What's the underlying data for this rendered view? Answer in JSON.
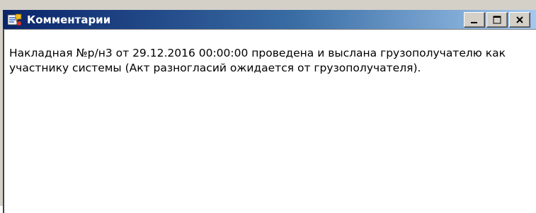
{
  "window": {
    "title": "Комментарии",
    "app_icon": "comments-app-icon",
    "buttons": {
      "minimize_icon": "minimize-icon",
      "maximize_icon": "maximize-icon",
      "close_icon": "close-icon"
    }
  },
  "comment": {
    "text": "Накладная №р/н3 от 29.12.2016 00:00:00 проведена  и выслана грузополучателю как участнику системы (Акт разногласий ожидается от грузополучателя)."
  },
  "colors": {
    "titlebar_start": "#0a246a",
    "titlebar_end": "#a6caf0",
    "title_text": "#ffffff",
    "content_background": "#ffffff"
  }
}
